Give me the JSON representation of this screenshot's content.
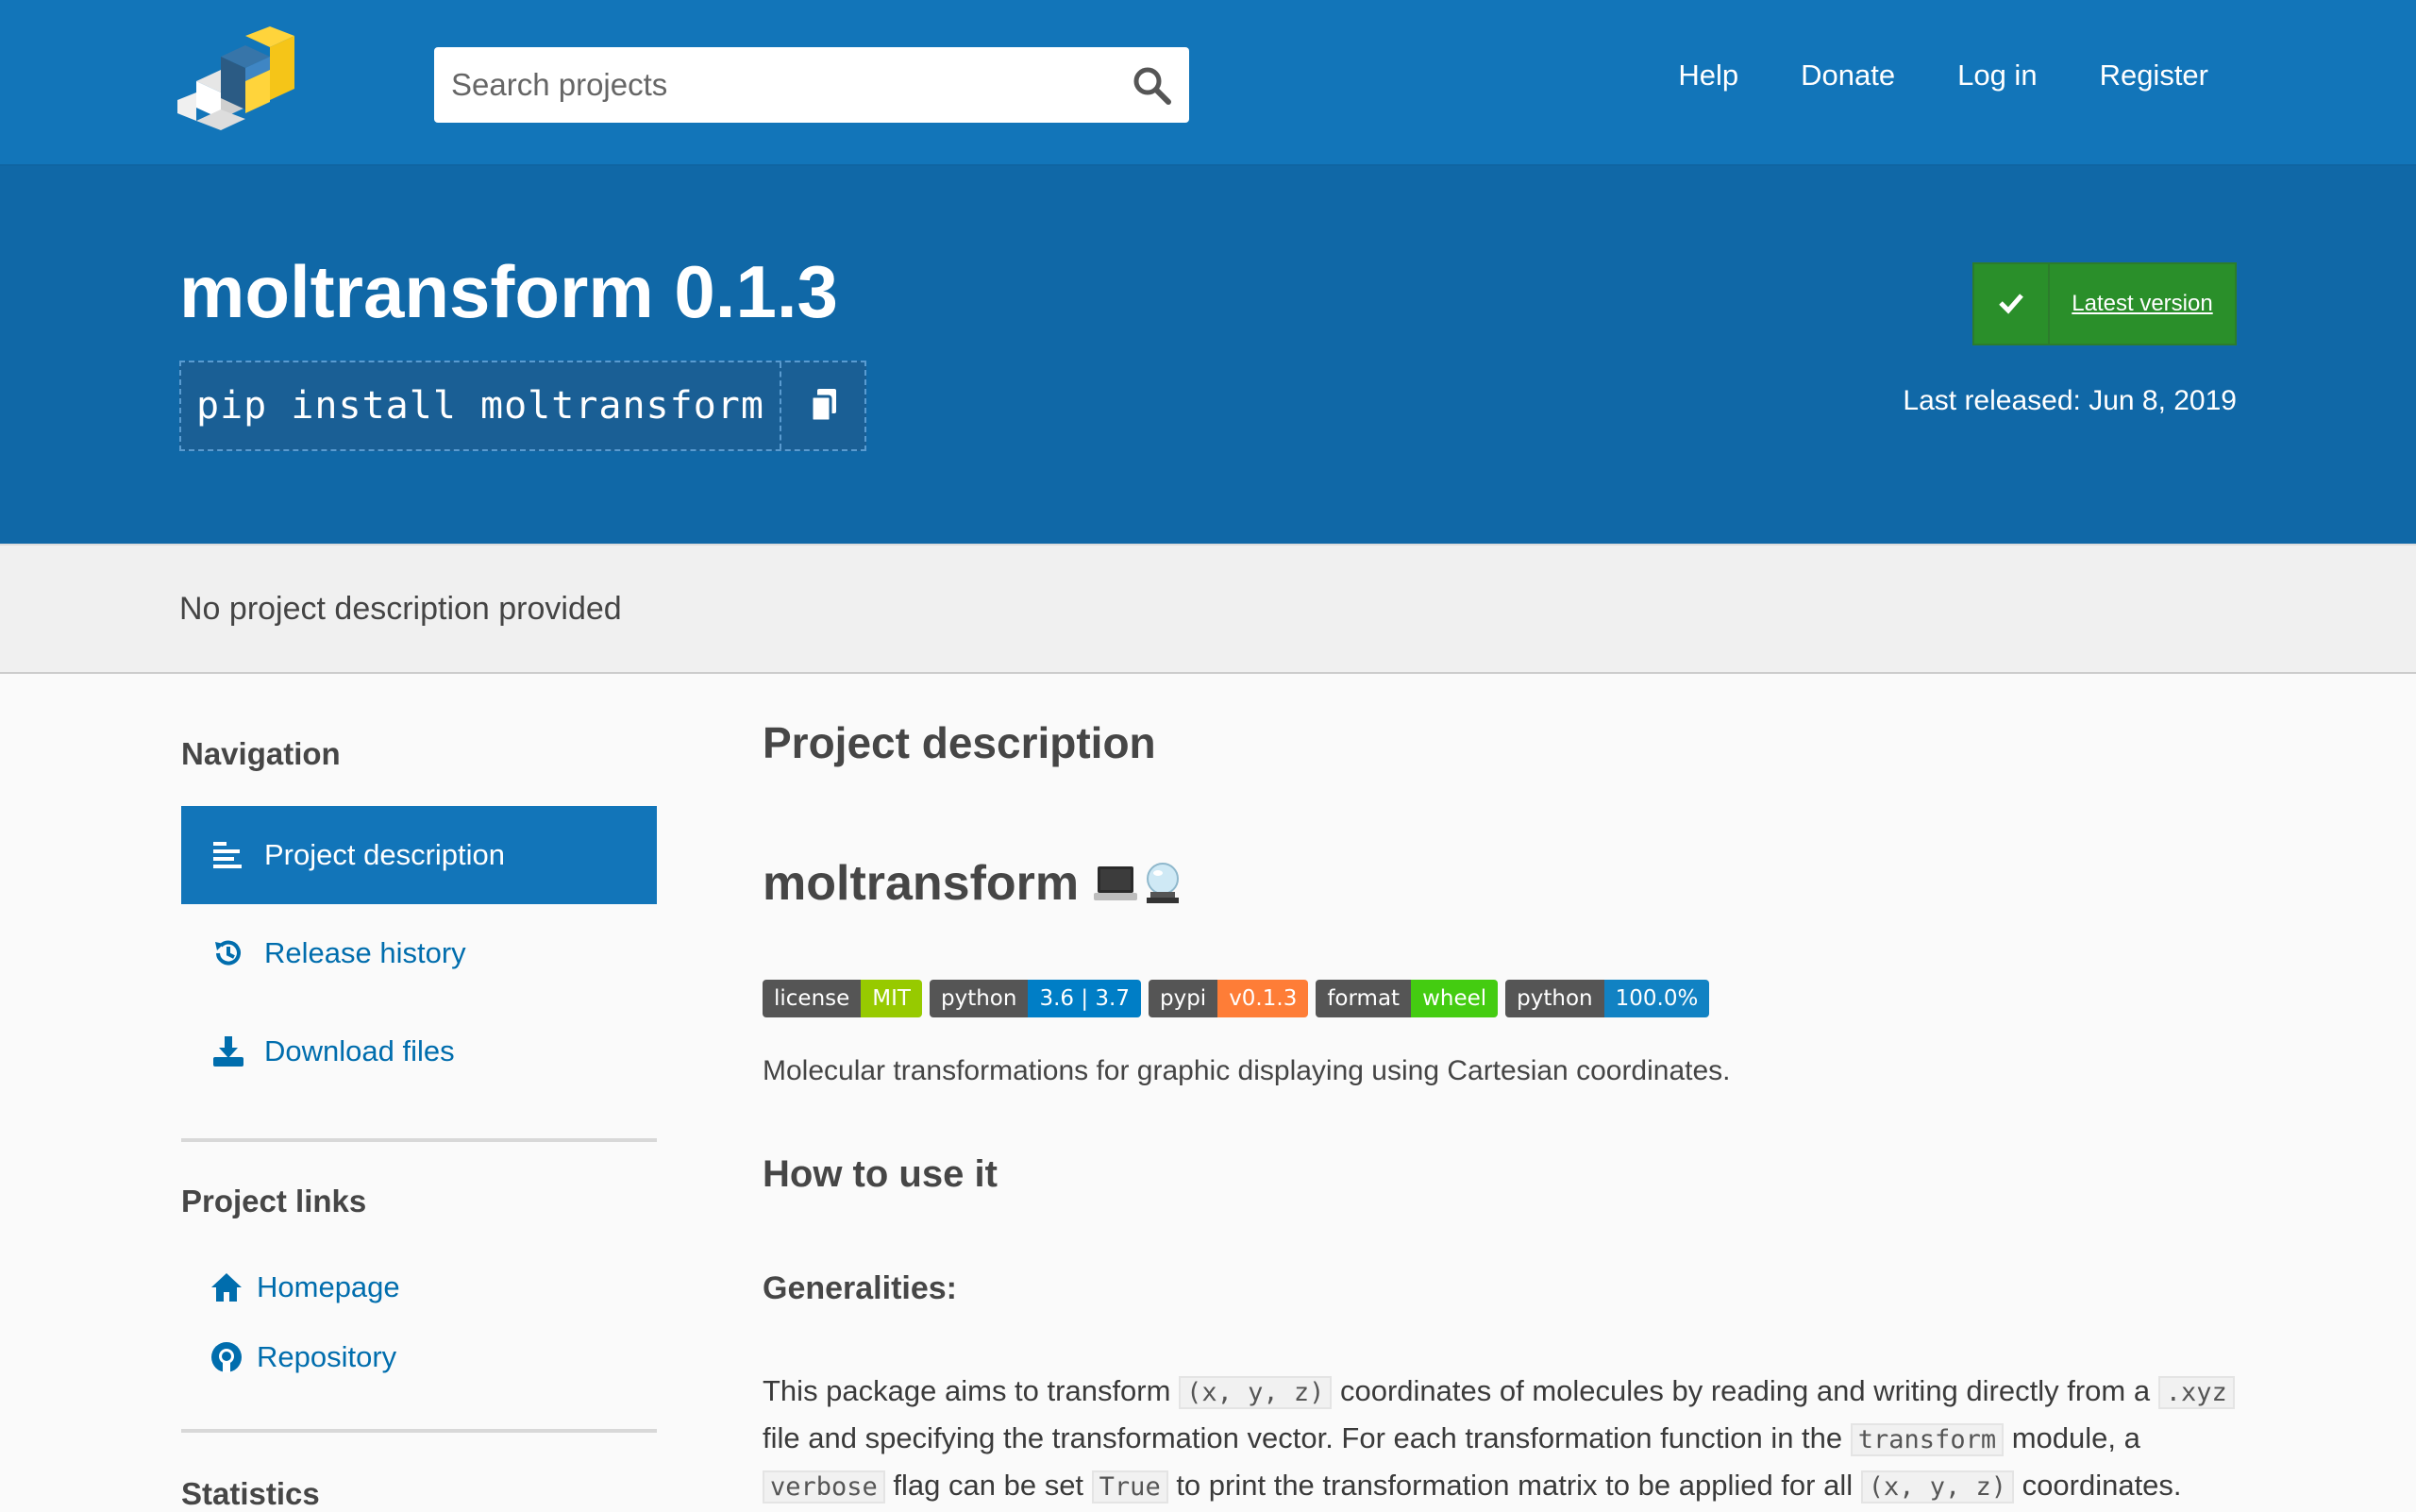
{
  "header": {
    "search_placeholder": "Search projects",
    "nav": [
      "Help",
      "Donate",
      "Log in",
      "Register"
    ]
  },
  "package": {
    "title": "moltransform 0.1.3",
    "pip_command": "pip install moltransform",
    "latest_label": "Latest version",
    "released": "Last released: Jun 8, 2019"
  },
  "summary": "No project description provided",
  "sidebar": {
    "navigation_heading": "Navigation",
    "nav_items": [
      {
        "label": "Project description",
        "icon": "align-left-icon",
        "active": true
      },
      {
        "label": "Release history",
        "icon": "history-icon",
        "active": false
      },
      {
        "label": "Download files",
        "icon": "download-icon",
        "active": false
      }
    ],
    "links_heading": "Project links",
    "links": [
      {
        "label": "Homepage",
        "icon": "home-icon"
      },
      {
        "label": "Repository",
        "icon": "github-icon"
      }
    ],
    "statistics_heading": "Statistics"
  },
  "main": {
    "heading": "Project description",
    "project_name": "moltransform",
    "badges": [
      {
        "key": "license",
        "value": "MIT",
        "color": "#97ca00"
      },
      {
        "key": "python",
        "value": "3.6 | 3.7",
        "color": "#007ec6"
      },
      {
        "key": "pypi",
        "value": "v0.1.3",
        "color": "#fe7d37"
      },
      {
        "key": "format",
        "value": "wheel",
        "color": "#4c1"
      },
      {
        "key": "python",
        "value": "100.0%",
        "color": "#1182c3"
      }
    ],
    "lead": "Molecular transformations for graphic displaying using Cartesian coordinates.",
    "how_heading": "How to use it",
    "generalities_heading": "Generalities:",
    "para_parts": [
      "This package aims to transform ",
      "(x, y, z)",
      " coordinates of molecules by reading and writing directly from a ",
      ".xyz",
      " file and specifying the transformation vector. For each transformation function in the ",
      "transform",
      " module, a ",
      "verbose",
      " flag can be set ",
      "True",
      " to print the transformation matrix to be applied for all ",
      "(x, y, z)",
      " coordinates."
    ]
  },
  "colors": {
    "header_bg": "#1275b9",
    "banner_bg": "#1068a7",
    "latest_green": "#2a8f2a",
    "link_blue": "#006dad"
  }
}
